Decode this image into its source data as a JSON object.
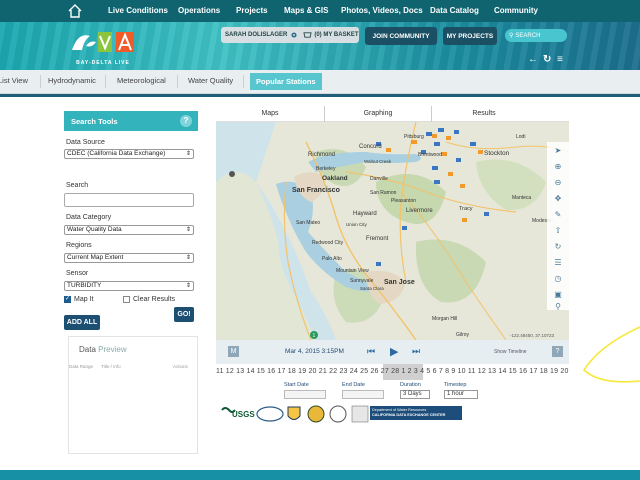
{
  "nav": {
    "items": [
      "Live Conditions",
      "Operations",
      "Projects",
      "Maps & GIS",
      "Photos, Videos, Docs",
      "Data Catalog",
      "Community"
    ]
  },
  "banner": {
    "logo_text": "BAY-DELTA LIVE",
    "user_name": "SARAH DOLISLAGER",
    "basket_label": "(0) MY BASKET",
    "join_label": "JOIN COMMUNITY",
    "projects_label": "MY PROJECTS",
    "search_label": "SEARCH"
  },
  "tabs": [
    "List View",
    "Hydrodynamic",
    "Meteorological",
    "Water Quality",
    "Popular Stations"
  ],
  "search_tools": {
    "title": "Search Tools",
    "help": "?",
    "data_source_label": "Data Source",
    "data_source_value": "CDEC (California Data Exchange)",
    "search_label": "Search",
    "category_label": "Data Category",
    "category_value": "Water Quality Data",
    "regions_label": "Regions",
    "regions_value": "Current Map Extent",
    "sensor_label": "Sensor",
    "sensor_value": "TURBIDITY",
    "map_it_label": "Map It",
    "clear_label": "Clear Results",
    "go_label": "GO!",
    "add_all_label": "ADD ALL"
  },
  "preview": {
    "title_a": "Data",
    "title_b": "Preview",
    "col1": "Data Range",
    "col2": "Title / Info",
    "col3": "Actions"
  },
  "right_tabs": [
    "Maps",
    "Graphing",
    "Results"
  ],
  "map": {
    "cities": [
      "Concord",
      "Walnut Creek",
      "Richmond",
      "Berkeley",
      "Oakland",
      "Brentwood",
      "Stockton",
      "Danville",
      "San Ramon",
      "San Francisco",
      "Hayward",
      "Livermore",
      "Tracy",
      "Fremont",
      "Manteca",
      "San Mateo",
      "Redwood City",
      "Palo Alto",
      "Mountain View",
      "Sunnyvale",
      "San Jose",
      "Santa Clara",
      "Morgan Hill",
      "Gilroy",
      "Pittsburg",
      "Pleasanton",
      "Lodi",
      "Union City",
      "Modesto"
    ],
    "coord": "-122.48450, 37.10723",
    "badge": "1"
  },
  "timebar": {
    "m_label": "M",
    "date": "Mar 4, 2015 3:15PM",
    "show_timeline": "Show Timeline",
    "q_label": "?",
    "numbers": "11 12 13 14 15 16 17 18 19 20 21 22 23 24 25 26 27 28 1 2 3 4 5 6 7 8 9 10 11 12 13 14 15 16 17 18 19 20"
  },
  "range": {
    "start_label": "Start Date",
    "end_label": "End Date",
    "duration_label": "Duration",
    "duration_value": "3 Days",
    "timestep_label": "Timestep",
    "timestep_value": "1 hour"
  },
  "logos": {
    "usgs": "USGS",
    "cdec_line1": "Department of Water Resources",
    "cdec_line2": "CALIFORNIA DATA EXCHANGE CENTER"
  },
  "colors": {
    "nav": "#0f6470",
    "teal": "#33b4bd",
    "dark_btn": "#1b4f63",
    "add_btn": "#1d4f73"
  }
}
